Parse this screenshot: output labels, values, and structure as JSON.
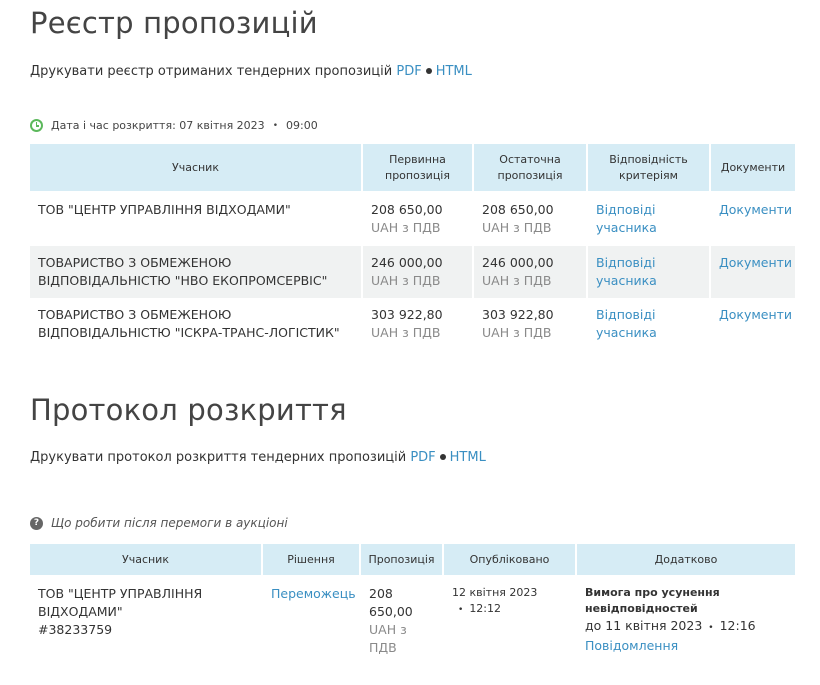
{
  "registry": {
    "title": "Реєстр пропозицій",
    "print_text": "Друкувати реєстр отриманих тендерних пропозицій",
    "pdf_label": "PDF",
    "html_label": "HTML",
    "opening_label": "Дата і час розкриття: 07 квітня 2023",
    "opening_time": "09:00",
    "columns": [
      "Учасник",
      "Первинна пропозиція",
      "Остаточна пропозиція",
      "Відповідність критеріям",
      "Документи"
    ],
    "rows": [
      {
        "participant": "ТОВ \"ЦЕНТР УПРАВЛІННЯ ВІДХОДАМИ\"",
        "initial_amount": "208 650,00",
        "initial_currency": "UAH з ПДВ",
        "final_amount": "208 650,00",
        "final_currency": "UAH з ПДВ",
        "compliance": "Відповіді учасника",
        "documents": "Документи"
      },
      {
        "participant": "ТОВАРИСТВО З ОБМЕЖЕНОЮ ВІДПОВІДАЛЬНІСТЮ \"НВО ЕКОПРОМСЕРВІС\"",
        "initial_amount": "246 000,00",
        "initial_currency": "UAH з ПДВ",
        "final_amount": "246 000,00",
        "final_currency": "UAH з ПДВ",
        "compliance": "Відповіді учасника",
        "documents": "Документи"
      },
      {
        "participant": "ТОВАРИСТВО З ОБМЕЖЕНОЮ ВІДПОВІДАЛЬНІСТЮ \"ІСКРА-ТРАНС-ЛОГІСТИК\"",
        "initial_amount": "303 922,80",
        "initial_currency": "UAH з ПДВ",
        "final_amount": "303 922,80",
        "final_currency": "UAH з ПДВ",
        "compliance": "Відповіді учасника",
        "documents": "Документи"
      }
    ]
  },
  "protocol": {
    "title": "Протокол розкриття",
    "print_text": "Друкувати протокол розкриття тендерних пропозицій",
    "pdf_label": "PDF",
    "html_label": "HTML",
    "help_link": "Що робити після перемоги в аукціоні",
    "columns": [
      "Учасник",
      "Рішення",
      "Пропозиція",
      "Опубліковано",
      "Додатково"
    ],
    "row": {
      "participant": "ТОВ \"ЦЕНТР УПРАВЛІННЯ ВІДХОДАМИ\"",
      "participant_code": "#38233759",
      "decision": "Переможець",
      "amount": "208 650,00",
      "currency": "UAH з ПДВ",
      "published_date": "12 квітня 2023",
      "published_time": "12:12",
      "extra_title": "Вимога про усунення невідповідностей",
      "extra_deadline": "до 11 квітня 2023",
      "extra_time": "12:16",
      "extra_link": "Повідомлення"
    }
  },
  "colors": {
    "link": "#3a8fc2",
    "header_bg": "#d6ecf5",
    "alt_row_bg": "#f0f2f2",
    "clock_icon": "#5cb85c"
  }
}
